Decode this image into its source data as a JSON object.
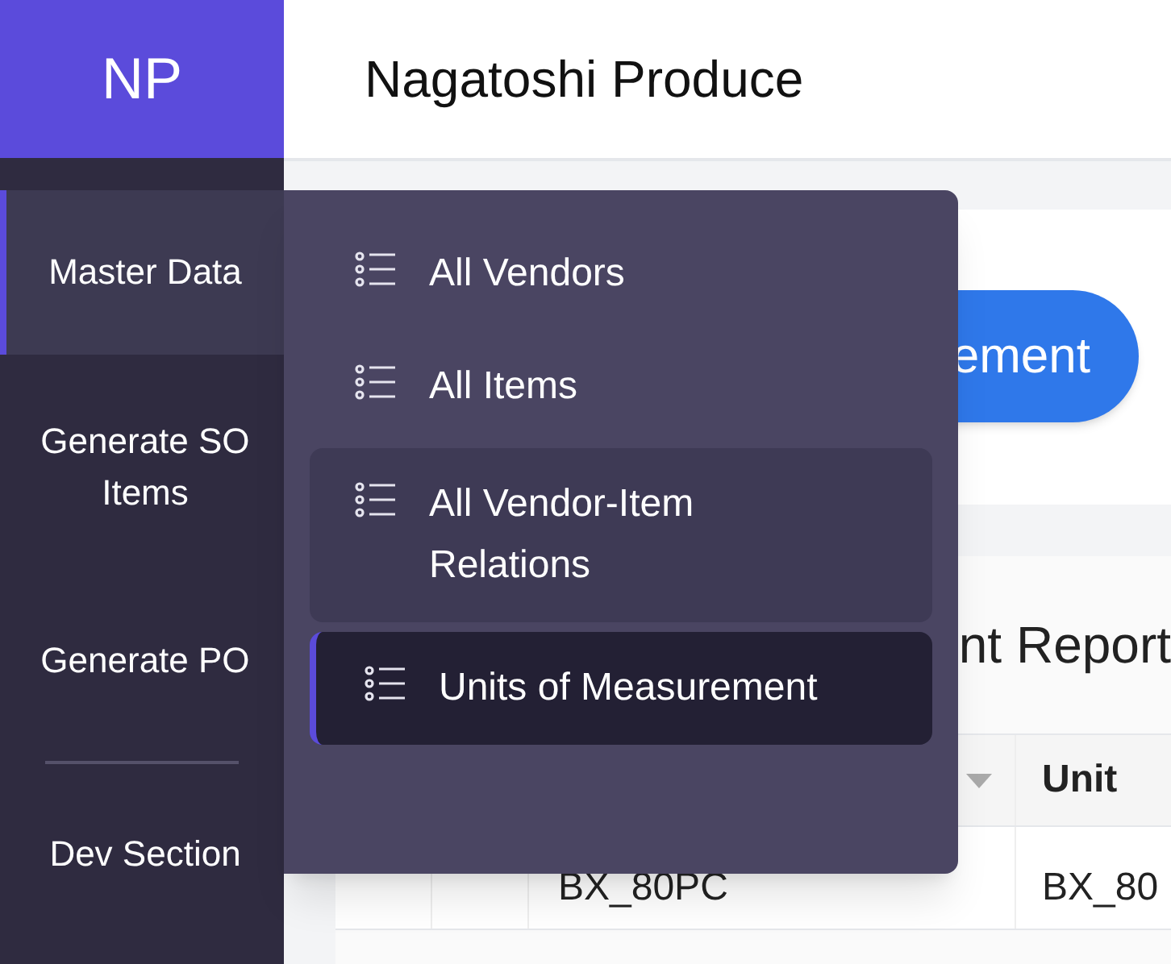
{
  "logo": {
    "text": "NP"
  },
  "header": {
    "title": "Nagatoshi Produce"
  },
  "sidebar": {
    "items": [
      {
        "label": "Master Data",
        "selected": true
      },
      {
        "label": "Generate SO Items",
        "selected": false
      },
      {
        "label": "Generate PO",
        "selected": false
      },
      {
        "label": "Dev Section",
        "selected": false
      }
    ]
  },
  "action_button": {
    "label": "ement"
  },
  "report": {
    "title": "nt Report",
    "columns": [
      "",
      "",
      "",
      "Unit"
    ],
    "rows": [
      [
        "",
        "",
        "BX_80PC",
        "BX_80"
      ]
    ]
  },
  "menu": {
    "items": [
      {
        "label": "All Vendors",
        "selected": false,
        "hovered": false
      },
      {
        "label": "All Items",
        "selected": false,
        "hovered": false
      },
      {
        "label": "All Vendor-Item Relations",
        "selected": false,
        "hovered": true
      },
      {
        "label": "Units of Measurement",
        "selected": true,
        "hovered": false
      }
    ]
  }
}
